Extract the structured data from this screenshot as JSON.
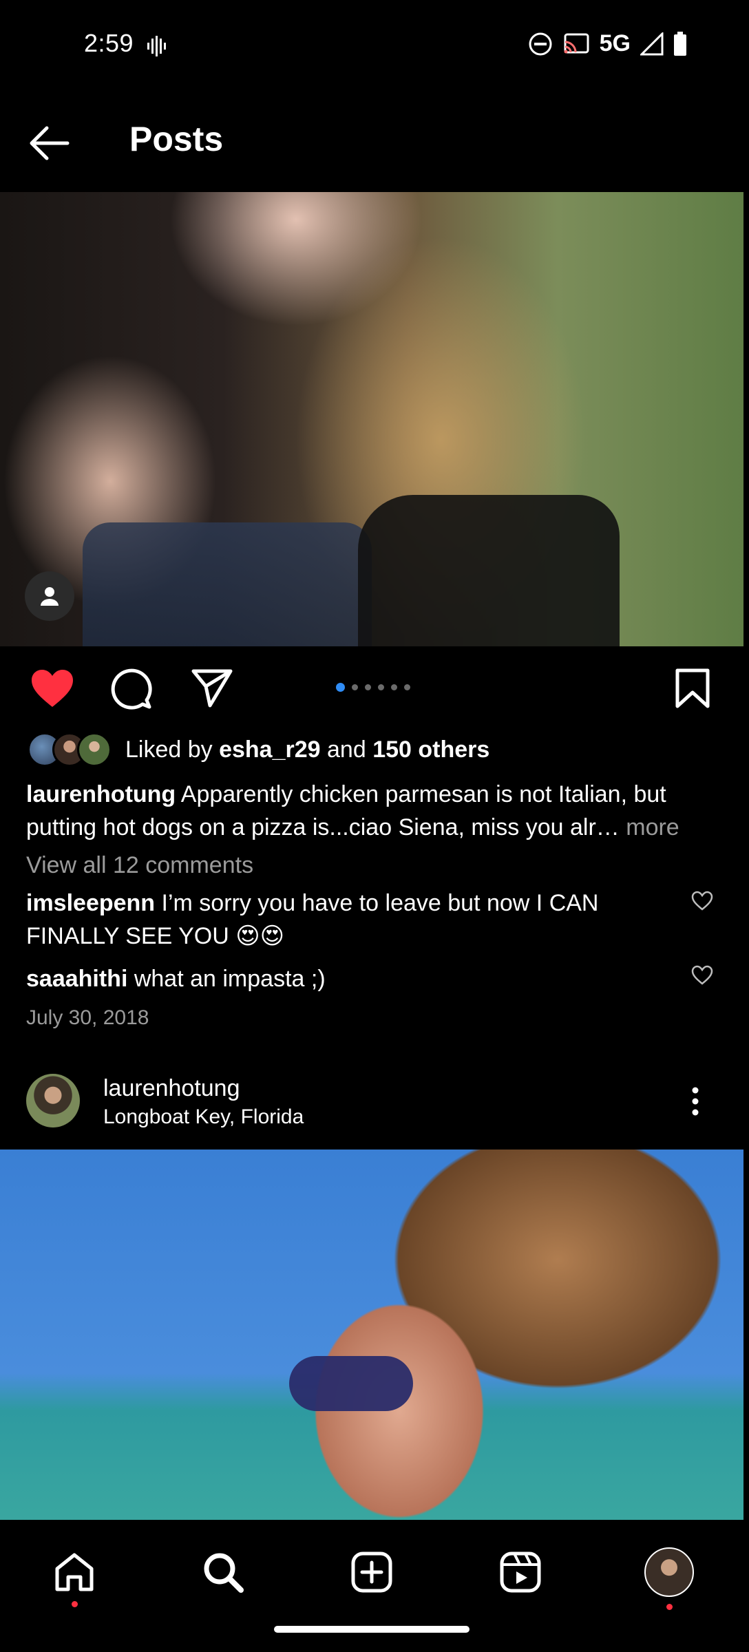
{
  "status_bar": {
    "time": "2:59",
    "network": "5G"
  },
  "header": {
    "title": "Posts"
  },
  "post1": {
    "carousel": {
      "count": 6,
      "active_index": 0
    },
    "likes": {
      "prefix": "Liked by",
      "user": "esha_r29",
      "joiner": "and",
      "others": "150 others"
    },
    "caption": {
      "username": "laurenhotung",
      "text": "Apparently chicken parmesan is not Italian, but putting hot dogs on a pizza is...ciao Siena, miss you alr",
      "ellipsis": "…",
      "more_label": "more"
    },
    "view_all_comments": "View all 12 comments",
    "comments": [
      {
        "username": "imsleepenn",
        "text": "I’m sorry you have to leave but now I CAN FINALLY SEE YOU 😍😍"
      },
      {
        "username": "saaahithi",
        "text": "what an impasta ;)"
      }
    ],
    "date": "July 30, 2018"
  },
  "post2": {
    "username": "laurenhotung",
    "location": "Longboat Key, Florida"
  },
  "colors": {
    "like_red": "#ff3040",
    "carousel_active": "#2f8cf5",
    "muted_text": "#9b9b9b"
  },
  "icons": {
    "back": "arrow-left-icon",
    "like": "heart-filled-icon",
    "comment": "speech-bubble-icon",
    "share": "paper-plane-icon",
    "save": "bookmark-icon",
    "more": "vertical-dots-icon",
    "home": "home-icon",
    "search": "search-icon",
    "create": "plus-square-icon",
    "reels": "reels-icon"
  }
}
